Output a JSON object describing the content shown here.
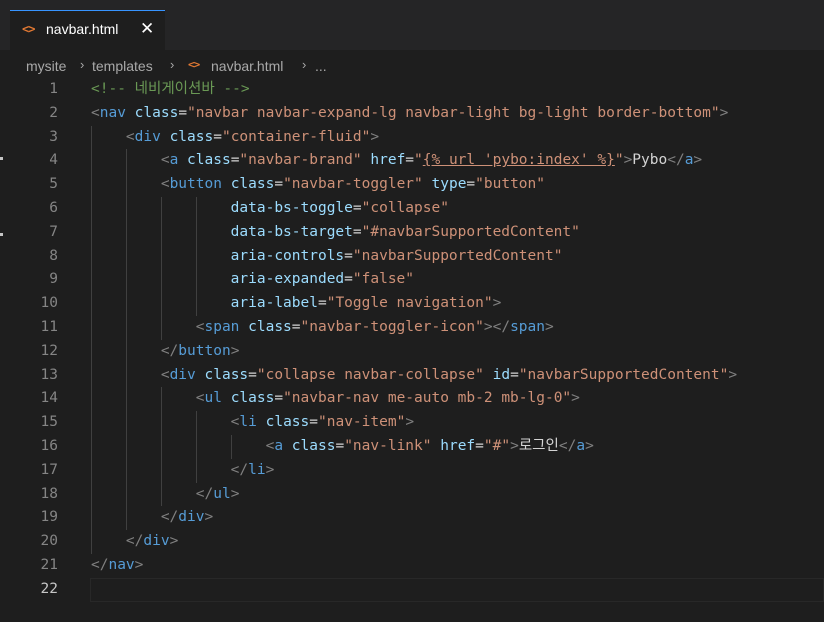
{
  "tab": {
    "icon": "code-file-icon",
    "label": "navbar.html",
    "close": "✕"
  },
  "breadcrumb": {
    "parts": [
      "mysite",
      "templates",
      "navbar.html",
      "..."
    ]
  },
  "editor": {
    "active_line": 22,
    "lines": [
      {
        "n": "1",
        "indent": 0,
        "tokens": [
          [
            "comment",
            "<!-- 네비게이션바 -->"
          ]
        ]
      },
      {
        "n": "2",
        "indent": 0,
        "tokens": [
          [
            "punc",
            "<"
          ],
          [
            "tag",
            "nav"
          ],
          [
            "text",
            " "
          ],
          [
            "attr",
            "class"
          ],
          [
            "eq",
            "="
          ],
          [
            "str",
            "\"navbar navbar-expand-lg navbar-light bg-light border-bottom\""
          ],
          [
            "punc",
            ">"
          ]
        ]
      },
      {
        "n": "3",
        "indent": 1,
        "tokens": [
          [
            "punc",
            "<"
          ],
          [
            "tag",
            "div"
          ],
          [
            "text",
            " "
          ],
          [
            "attr",
            "class"
          ],
          [
            "eq",
            "="
          ],
          [
            "str",
            "\"container-fluid\""
          ],
          [
            "punc",
            ">"
          ]
        ]
      },
      {
        "n": "4",
        "indent": 2,
        "tokens": [
          [
            "punc",
            "<"
          ],
          [
            "tag",
            "a"
          ],
          [
            "text",
            " "
          ],
          [
            "attr",
            "class"
          ],
          [
            "eq",
            "="
          ],
          [
            "str",
            "\"navbar-brand\""
          ],
          [
            "text",
            " "
          ],
          [
            "attr",
            "href"
          ],
          [
            "eq",
            "="
          ],
          [
            "str",
            "\""
          ],
          [
            "str_ul",
            "{% url 'pybo:index' %}"
          ],
          [
            "str",
            "\""
          ],
          [
            "punc",
            ">"
          ],
          [
            "text",
            "Pybo"
          ],
          [
            "punc",
            "</"
          ],
          [
            "tag",
            "a"
          ],
          [
            "punc",
            ">"
          ]
        ]
      },
      {
        "n": "5",
        "indent": 2,
        "tokens": [
          [
            "punc",
            "<"
          ],
          [
            "tag",
            "button"
          ],
          [
            "text",
            " "
          ],
          [
            "attr",
            "class"
          ],
          [
            "eq",
            "="
          ],
          [
            "str",
            "\"navbar-toggler\""
          ],
          [
            "text",
            " "
          ],
          [
            "attr",
            "type"
          ],
          [
            "eq",
            "="
          ],
          [
            "str",
            "\"button\""
          ]
        ]
      },
      {
        "n": "6",
        "indent": 4,
        "tokens": [
          [
            "attr",
            "data-bs-toggle"
          ],
          [
            "eq",
            "="
          ],
          [
            "str",
            "\"collapse\""
          ]
        ]
      },
      {
        "n": "7",
        "indent": 4,
        "tokens": [
          [
            "attr",
            "data-bs-target"
          ],
          [
            "eq",
            "="
          ],
          [
            "str",
            "\"#navbarSupportedContent\""
          ]
        ]
      },
      {
        "n": "8",
        "indent": 4,
        "tokens": [
          [
            "attr",
            "aria-controls"
          ],
          [
            "eq",
            "="
          ],
          [
            "str",
            "\"navbarSupportedContent\""
          ]
        ]
      },
      {
        "n": "9",
        "indent": 4,
        "tokens": [
          [
            "attr",
            "aria-expanded"
          ],
          [
            "eq",
            "="
          ],
          [
            "str",
            "\"false\""
          ]
        ]
      },
      {
        "n": "10",
        "indent": 4,
        "tokens": [
          [
            "attr",
            "aria-label"
          ],
          [
            "eq",
            "="
          ],
          [
            "str",
            "\"Toggle navigation\""
          ],
          [
            "punc",
            ">"
          ]
        ]
      },
      {
        "n": "11",
        "indent": 3,
        "tokens": [
          [
            "punc",
            "<"
          ],
          [
            "tag",
            "span"
          ],
          [
            "text",
            " "
          ],
          [
            "attr",
            "class"
          ],
          [
            "eq",
            "="
          ],
          [
            "str",
            "\"navbar-toggler-icon\""
          ],
          [
            "punc",
            "></"
          ],
          [
            "tag",
            "span"
          ],
          [
            "punc",
            ">"
          ]
        ]
      },
      {
        "n": "12",
        "indent": 2,
        "tokens": [
          [
            "punc",
            "</"
          ],
          [
            "tag",
            "button"
          ],
          [
            "punc",
            ">"
          ]
        ]
      },
      {
        "n": "13",
        "indent": 2,
        "tokens": [
          [
            "punc",
            "<"
          ],
          [
            "tag",
            "div"
          ],
          [
            "text",
            " "
          ],
          [
            "attr",
            "class"
          ],
          [
            "eq",
            "="
          ],
          [
            "str",
            "\"collapse navbar-collapse\""
          ],
          [
            "text",
            " "
          ],
          [
            "attr",
            "id"
          ],
          [
            "eq",
            "="
          ],
          [
            "str",
            "\"navbarSupportedContent\""
          ],
          [
            "punc",
            ">"
          ]
        ]
      },
      {
        "n": "14",
        "indent": 3,
        "tokens": [
          [
            "punc",
            "<"
          ],
          [
            "tag",
            "ul"
          ],
          [
            "text",
            " "
          ],
          [
            "attr",
            "class"
          ],
          [
            "eq",
            "="
          ],
          [
            "str",
            "\"navbar-nav me-auto mb-2 mb-lg-0\""
          ],
          [
            "punc",
            ">"
          ]
        ]
      },
      {
        "n": "15",
        "indent": 4,
        "tokens": [
          [
            "punc",
            "<"
          ],
          [
            "tag",
            "li"
          ],
          [
            "text",
            " "
          ],
          [
            "attr",
            "class"
          ],
          [
            "eq",
            "="
          ],
          [
            "str",
            "\"nav-item\""
          ],
          [
            "punc",
            ">"
          ]
        ]
      },
      {
        "n": "16",
        "indent": 5,
        "tokens": [
          [
            "punc",
            "<"
          ],
          [
            "tag",
            "a"
          ],
          [
            "text",
            " "
          ],
          [
            "attr",
            "class"
          ],
          [
            "eq",
            "="
          ],
          [
            "str",
            "\"nav-link\""
          ],
          [
            "text",
            " "
          ],
          [
            "attr",
            "href"
          ],
          [
            "eq",
            "="
          ],
          [
            "str",
            "\"#\""
          ],
          [
            "punc",
            ">"
          ],
          [
            "text",
            "로그인"
          ],
          [
            "punc",
            "</"
          ],
          [
            "tag",
            "a"
          ],
          [
            "punc",
            ">"
          ]
        ]
      },
      {
        "n": "17",
        "indent": 4,
        "tokens": [
          [
            "punc",
            "</"
          ],
          [
            "tag",
            "li"
          ],
          [
            "punc",
            ">"
          ]
        ]
      },
      {
        "n": "18",
        "indent": 3,
        "tokens": [
          [
            "punc",
            "</"
          ],
          [
            "tag",
            "ul"
          ],
          [
            "punc",
            ">"
          ]
        ]
      },
      {
        "n": "19",
        "indent": 2,
        "tokens": [
          [
            "punc",
            "</"
          ],
          [
            "tag",
            "div"
          ],
          [
            "punc",
            ">"
          ]
        ]
      },
      {
        "n": "20",
        "indent": 1,
        "tokens": [
          [
            "punc",
            "</"
          ],
          [
            "tag",
            "div"
          ],
          [
            "punc",
            ">"
          ]
        ]
      },
      {
        "n": "21",
        "indent": 0,
        "tokens": [
          [
            "punc",
            "</"
          ],
          [
            "tag",
            "nav"
          ],
          [
            "punc",
            ">"
          ]
        ]
      },
      {
        "n": "22",
        "indent": 0,
        "tokens": []
      }
    ]
  }
}
